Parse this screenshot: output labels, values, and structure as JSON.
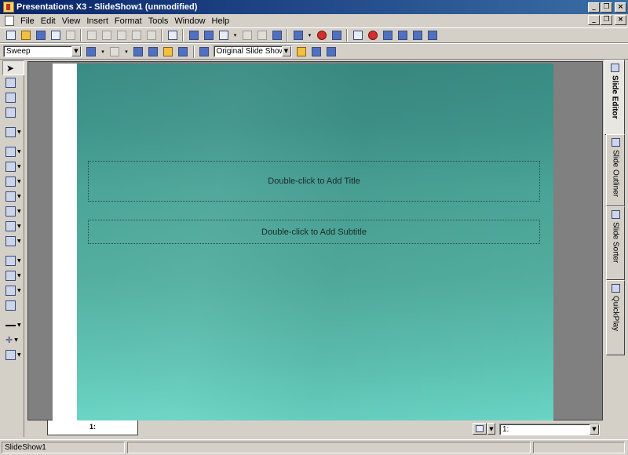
{
  "window": {
    "title": "Presentations X3 - SlideShow1 (unmodified)"
  },
  "menu": {
    "items": [
      "File",
      "Edit",
      "View",
      "Insert",
      "Format",
      "Tools",
      "Window",
      "Help"
    ]
  },
  "toolbar2": {
    "transition_value": "Sweep",
    "slideshow_value": "Original Slide Show"
  },
  "slide": {
    "title_placeholder": "Double-click to Add Title",
    "subtitle_placeholder": "Double-click to Add Subtitle"
  },
  "bottom": {
    "slide_tab_label": "1:",
    "slide_select_value": "1:"
  },
  "right_tabs": [
    "Slide Editor",
    "Slide Outliner",
    "Slide Sorter",
    "QuickPlay"
  ],
  "status": {
    "document": "SlideShow1"
  }
}
